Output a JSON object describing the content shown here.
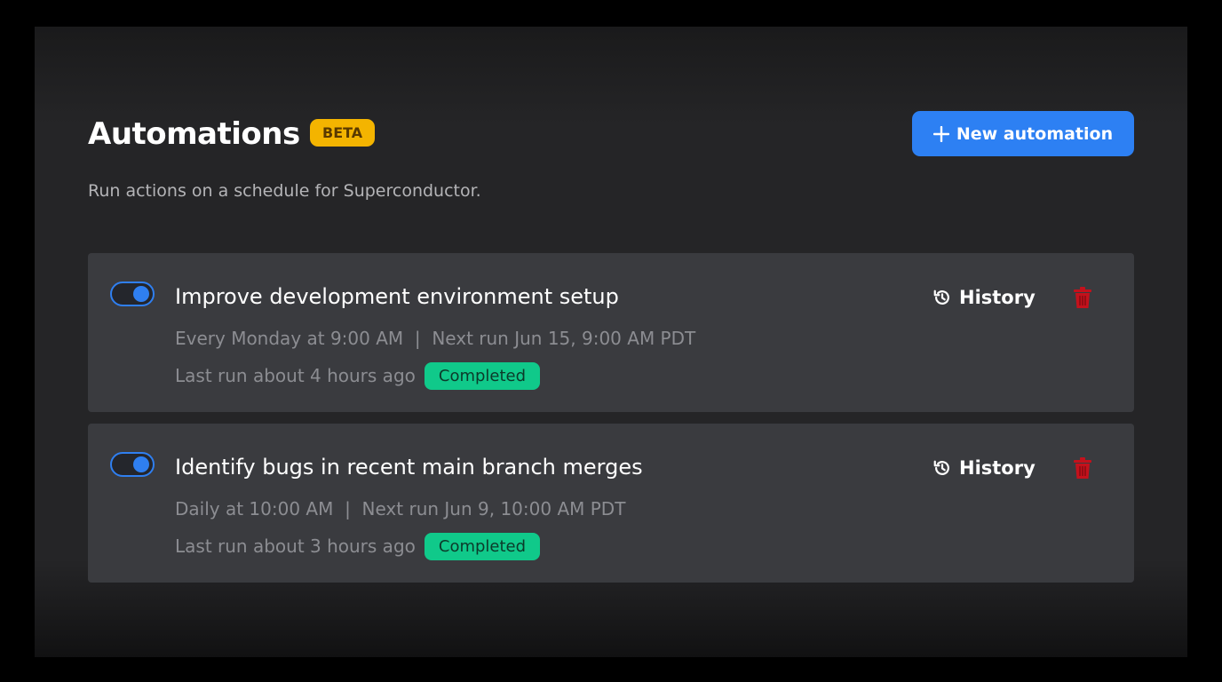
{
  "header": {
    "title": "Automations",
    "badge": "BETA",
    "new_button_label": "New automation",
    "subtitle": "Run actions on a schedule for Superconductor."
  },
  "automations": [
    {
      "enabled": true,
      "title": "Improve development environment setup",
      "schedule": "Every Monday at 9:00 AM  |  Next run Jun 15, 9:00 AM PDT",
      "last_run": "Last run about 4 hours ago",
      "status": "Completed",
      "history_label": "History"
    },
    {
      "enabled": true,
      "title": "Identify bugs in recent main branch merges",
      "schedule": "Daily at 10:00 AM  |  Next run Jun 9, 10:00 AM PDT",
      "last_run": "Last run about 3 hours ago",
      "status": "Completed",
      "history_label": "History"
    }
  ],
  "colors": {
    "accent": "#2d80f3",
    "beta": "#f4b400",
    "success": "#10c98a",
    "danger": "#c4111c"
  },
  "icons": {
    "new_button": "plus-icon",
    "history": "history-icon",
    "delete": "trash-icon"
  }
}
